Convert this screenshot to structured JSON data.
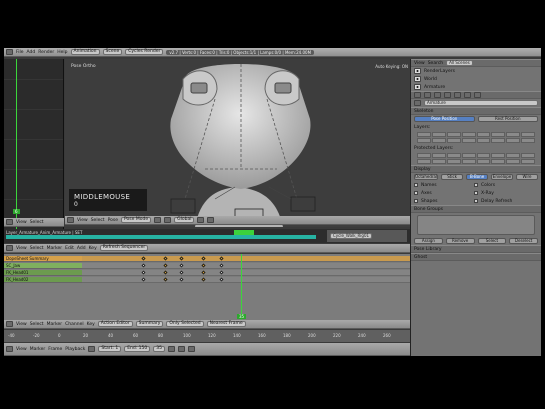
{
  "topbar": {
    "menus": [
      "File",
      "Add",
      "Render",
      "Help"
    ],
    "layout": "Animation",
    "scene": "Scene",
    "engine": "Cycles Render",
    "version_info": "v2.7 | Verts:0 | Faces:0 | Tris:0 | Objects:1/1 | Lamps:0/0 | Mem:24.00M"
  },
  "left_graph": {
    "frame_badge": "6"
  },
  "left_header": {
    "items": [
      "View",
      "Select"
    ]
  },
  "viewport": {
    "view_label": "Pose Ortho",
    "right_label": "Auto Keying: ON",
    "stats": "(35) Armature : SC_Jaw ... Verts 0 | Faces 0",
    "overlay_title": "MIDDLEMOUSE",
    "overlay_value": "0"
  },
  "viewport_header": {
    "items": [
      "View",
      "Select",
      "Pose"
    ],
    "mode": "Pose Mode",
    "pivot": "Global"
  },
  "strip": {
    "name": "Layer_Armature_Anim_Armature | SET",
    "side_label": "Cycle_Walk_Rig01"
  },
  "strip_header": {
    "items": [
      "View",
      "Select",
      "Marker",
      "Edit",
      "Add",
      "Key"
    ],
    "button": "Refresh Sequencer"
  },
  "dopesheet": {
    "channels": [
      {
        "label": "DopeSheet Summary",
        "kind": "summary"
      },
      {
        "label": "SC_Jaw",
        "kind": "green"
      },
      {
        "label": "FK_Head01",
        "kind": "green2"
      },
      {
        "label": "FK_Head02",
        "kind": "green2"
      }
    ],
    "frame_badge": "35"
  },
  "dope_header": {
    "items": [
      "View",
      "Select",
      "Marker",
      "Channel",
      "Key"
    ],
    "mode": "Action Editor",
    "action": "Summary",
    "filter": "Only Selected",
    "interp": "Nearest Frame"
  },
  "ruler": {
    "ticks": [
      "-40",
      "-20",
      "0",
      "20",
      "40",
      "60",
      "80",
      "100",
      "120",
      "140",
      "160",
      "180",
      "200",
      "220",
      "240",
      "260"
    ]
  },
  "timeline_header": {
    "items": [
      "View",
      "Marker",
      "Frame",
      "Playback"
    ],
    "start_label": "Start: 1",
    "end_label": "End: 150",
    "current_label": "35"
  },
  "props": {
    "tabs_top": [
      "View",
      "Search",
      "All Scenes"
    ],
    "outliner_items": [
      "RenderLayers",
      "World",
      "Armature"
    ],
    "name_field": "Armature",
    "section_skeleton": "Skeleton",
    "pose_position": "Pose Position",
    "rest_position": "Rest Position",
    "layers_label": "Layers:",
    "protected_label": "Protected Layers:",
    "section_display": "Display",
    "display_modes": [
      "Octahedral",
      "Stick",
      "B-Bone",
      "Envelope",
      "Wire"
    ],
    "checks_left": [
      "Names",
      "Axes",
      "Shapes"
    ],
    "checks_right": [
      "Colors",
      "X-Ray",
      "Delay Refresh"
    ],
    "section_bone_groups": "Bone Groups",
    "bone_group_buttons": [
      "Assign",
      "Remove",
      "Select",
      "Deselect"
    ],
    "section_pose_library": "Pose Library",
    "section_ghost": "Ghost"
  }
}
